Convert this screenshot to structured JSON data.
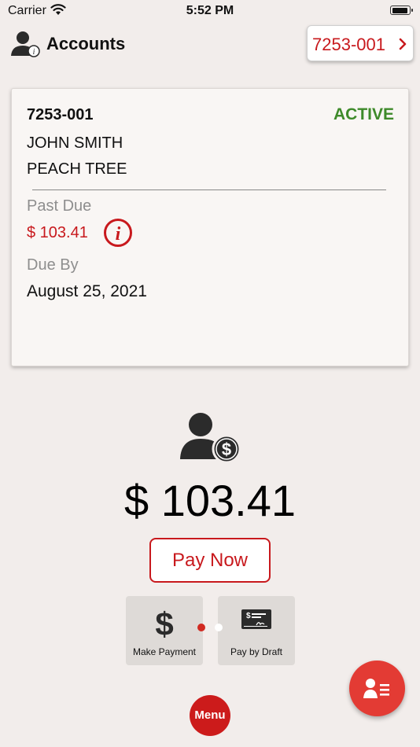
{
  "status_bar": {
    "carrier": "Carrier",
    "time": "5:52 PM",
    "icons": [
      "wifi-icon",
      "battery-icon"
    ]
  },
  "header": {
    "title": "Accounts",
    "icon": "account-info-icon",
    "account_chip": "7253-001"
  },
  "account_card": {
    "account_number": "7253-001",
    "status": "ACTIVE",
    "name": "JOHN SMITH",
    "address": "PEACH TREE",
    "past_due_label": "Past Due",
    "past_due_amount": "$ 103.41",
    "due_by_label": "Due By",
    "due_date": "August 25, 2021"
  },
  "balance": {
    "amount": "$ 103.41",
    "pay_now_label": "Pay Now"
  },
  "payment_options": [
    {
      "label": "Make Payment",
      "icon": "dollar-icon"
    },
    {
      "label": "Pay by Draft",
      "icon": "check-icon"
    }
  ],
  "pager": {
    "pages": 2,
    "active": 1
  },
  "menu_label": "Menu",
  "colors": {
    "accent": "#c8191d",
    "active": "#3e8a2a",
    "background": "#f2edeb",
    "fab": "#e33b34"
  }
}
